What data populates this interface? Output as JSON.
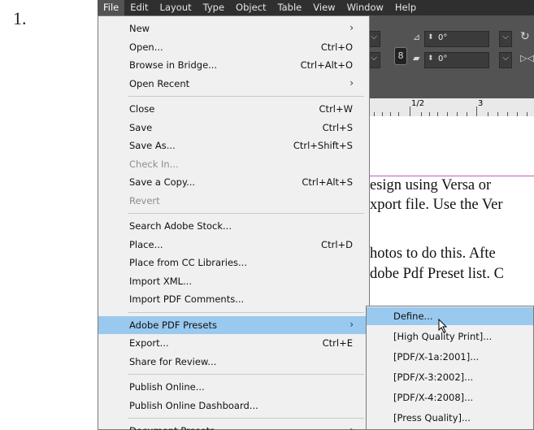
{
  "step_number": "1.",
  "menubar": [
    "File",
    "Edit",
    "Layout",
    "Type",
    "Object",
    "Table",
    "View",
    "Window",
    "Help"
  ],
  "file_menu": {
    "groups": [
      [
        {
          "label": "New",
          "shortcut": "",
          "submenu": true
        },
        {
          "label": "Open...",
          "shortcut": "Ctrl+O"
        },
        {
          "label": "Browse in Bridge...",
          "shortcut": "Ctrl+Alt+O"
        },
        {
          "label": "Open Recent",
          "shortcut": "",
          "submenu": true
        }
      ],
      [
        {
          "label": "Close",
          "shortcut": "Ctrl+W"
        },
        {
          "label": "Save",
          "shortcut": "Ctrl+S"
        },
        {
          "label": "Save As...",
          "shortcut": "Ctrl+Shift+S"
        },
        {
          "label": "Check In...",
          "shortcut": "",
          "disabled": true
        },
        {
          "label": "Save a Copy...",
          "shortcut": "Ctrl+Alt+S"
        },
        {
          "label": "Revert",
          "shortcut": "",
          "disabled": true
        }
      ],
      [
        {
          "label": "Search Adobe Stock...",
          "shortcut": ""
        },
        {
          "label": "Place...",
          "shortcut": "Ctrl+D"
        },
        {
          "label": "Place from CC Libraries...",
          "shortcut": ""
        },
        {
          "label": "Import XML...",
          "shortcut": ""
        },
        {
          "label": "Import PDF Comments...",
          "shortcut": ""
        }
      ],
      [
        {
          "label": "Adobe PDF Presets",
          "shortcut": "",
          "submenu": true,
          "highlighted": true
        },
        {
          "label": "Export...",
          "shortcut": "Ctrl+E"
        },
        {
          "label": "Share for Review...",
          "shortcut": ""
        }
      ],
      [
        {
          "label": "Publish Online...",
          "shortcut": ""
        },
        {
          "label": "Publish Online Dashboard...",
          "shortcut": ""
        }
      ],
      [
        {
          "label": "Document Presets",
          "shortcut": "",
          "submenu": true
        }
      ]
    ]
  },
  "pdf_presets_submenu": [
    {
      "label": "Define...",
      "highlighted": true
    },
    {
      "label": "[High Quality Print]..."
    },
    {
      "label": "[PDF/X-1a:2001]..."
    },
    {
      "label": "[PDF/X-3:2002]..."
    },
    {
      "label": "[PDF/X-4:2008]..."
    },
    {
      "label": "[Press Quality]..."
    }
  ],
  "toolbar": {
    "angle_1": "0°",
    "angle_2": "0°",
    "link_icon": "chain-link-icon"
  },
  "ruler": {
    "labels": [
      "1/2",
      "3"
    ]
  },
  "document_text": [
    "esign using Versa or",
    "xport file. Use the Ver",
    "",
    "hotos to do this. Afte",
    "dobe Pdf Preset list. C"
  ],
  "colors": {
    "menubar": "#2f2f2f",
    "menu_bg": "#f0f0f0",
    "highlight": "#99c9ef",
    "guide": "#c25bb7",
    "panel": "#535353"
  }
}
